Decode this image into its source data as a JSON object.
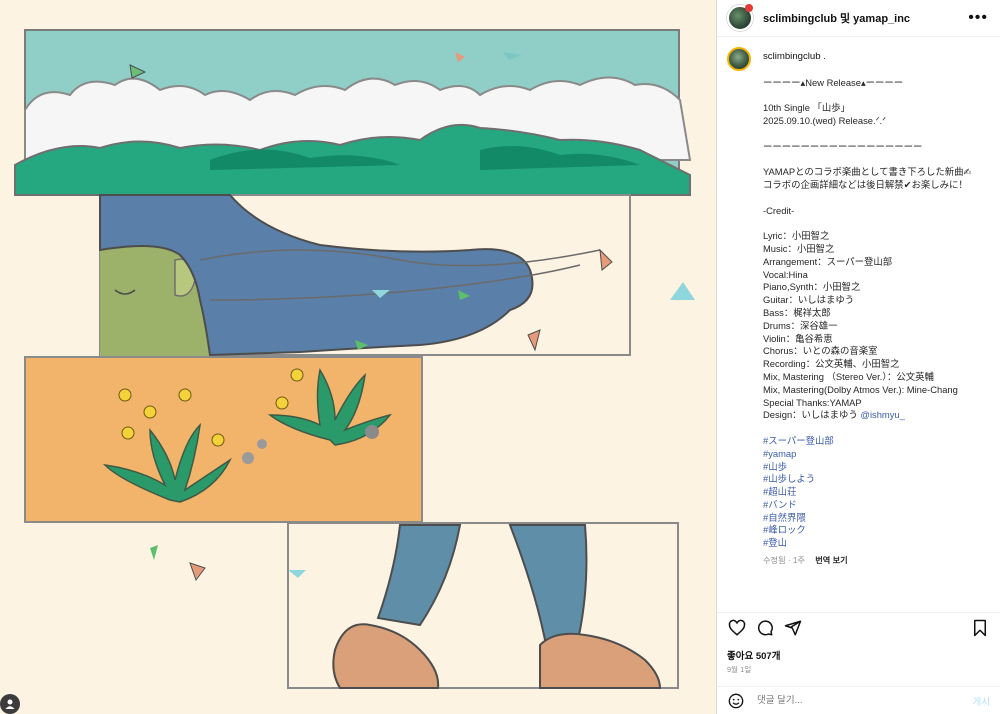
{
  "header": {
    "title": "sclimbingclub 및 yamap_inc",
    "more_icon": "more-horizontal-icon"
  },
  "caption": {
    "username": "sclimbingclub .",
    "lines": [
      "ーーーー▴New Release▴ーーーー",
      "",
      "10th Single 「山歩」",
      "2025.09.10.(wed) Release.ᐟ.ᐟ",
      "",
      "ーーーーーーーーーーーーーーーーー",
      "",
      "YAMAPとのコラボ楽曲として書き下ろした新曲✍",
      "コラボの企画詳細などは後日解禁✔お楽しみに！",
      "",
      "-Credit-",
      "",
      "Lyric：小田智之",
      "Music：小田智之",
      "Arrangement：スーパー登山部",
      "Vocal:Hina",
      "Piano,Synth：小田智之",
      "Guitar：いしはまゆう",
      "Bass：梶祥太郎",
      "Drums：深谷雄一",
      "Violin：亀谷希恵",
      "Chorus：いとの森の音楽室",
      "Recording：公文英輔、小田智之",
      "Mix, Mastering （Stereo Ver.）：公文英輔",
      "Mix, Mastering(Dolby Atmos Ver.): Mine-Chang",
      "Special Thanks:YAMAP"
    ],
    "design_prefix": "Design：いしはまゆう ",
    "design_mention": "@ishmyu_",
    "hashtags": [
      "#スーパー登山部",
      "#yamap",
      "#山歩",
      "#山歩しよう",
      "#超山荘",
      "#バンド",
      "#自然界隈",
      "#峰ロック",
      "#登山"
    ],
    "edited": "수정됨 · 1주",
    "translate": "번역 보기"
  },
  "actions": {
    "like_icon": "heart-icon",
    "comment_icon": "comment-icon",
    "share_icon": "share-icon",
    "save_icon": "bookmark-icon"
  },
  "likes": "좋아요 507개",
  "date": "9월 1일",
  "comment": {
    "placeholder": "댓글 달기...",
    "post_label": "게시",
    "emoji_icon": "smiley-icon"
  },
  "colors": {
    "sky": "#8fcfc8",
    "mountains": "#1f9e79",
    "hair": "#5a7fa8",
    "face": "#9cb16a",
    "field": "#f2b36a",
    "jeans": "#5f8fa8",
    "shoes": "#d9a07a",
    "background": "#fdf3e2",
    "link": "#3a5aa8"
  }
}
